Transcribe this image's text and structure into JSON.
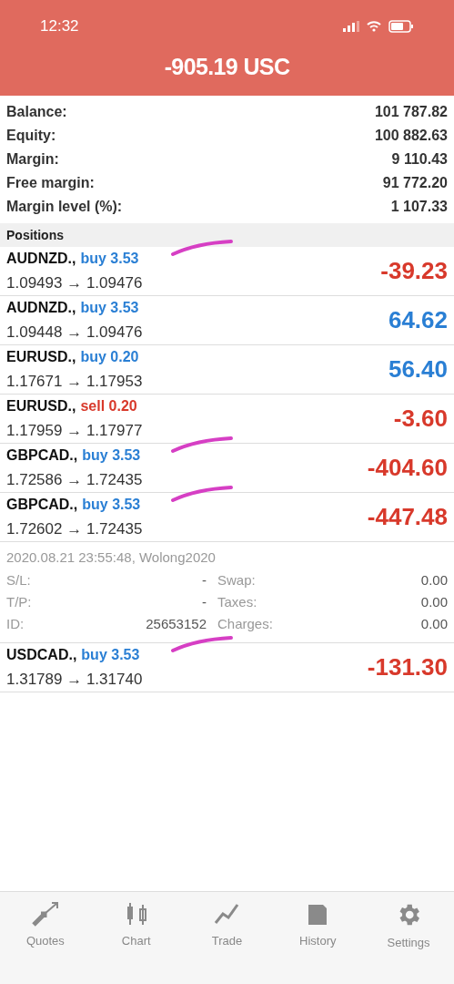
{
  "status_bar": {
    "time": "12:32"
  },
  "header": {
    "title": "-905.19 USC"
  },
  "summary": [
    {
      "label": "Balance:",
      "value": "101 787.82"
    },
    {
      "label": "Equity:",
      "value": "100 882.63"
    },
    {
      "label": "Margin:",
      "value": "9 110.43"
    },
    {
      "label": "Free margin:",
      "value": "91 772.20"
    },
    {
      "label": "Margin level (%):",
      "value": "1 107.33"
    }
  ],
  "positions_title": "Positions",
  "positions": [
    {
      "symbol": "AUDNZD.,",
      "kind": "buy",
      "order": "buy 3.53",
      "prices": "1.09493 → 1.09476",
      "profit": "-39.23",
      "color": "#d8392b",
      "marked": true
    },
    {
      "symbol": "AUDNZD.,",
      "kind": "buy",
      "order": "buy 3.53",
      "prices": "1.09448 → 1.09476",
      "profit": "64.62",
      "color": "#2a7fd4",
      "marked": false
    },
    {
      "symbol": "EURUSD.,",
      "kind": "buy",
      "order": "buy 0.20",
      "prices": "1.17671 → 1.17953",
      "profit": "56.40",
      "color": "#2a7fd4",
      "marked": false
    },
    {
      "symbol": "EURUSD.,",
      "kind": "sell",
      "order": "sell 0.20",
      "prices": "1.17959 → 1.17977",
      "profit": "-3.60",
      "color": "#d8392b",
      "marked": false
    },
    {
      "symbol": "GBPCAD.,",
      "kind": "buy",
      "order": "buy 3.53",
      "prices": "1.72586 → 1.72435",
      "profit": "-404.60",
      "color": "#d8392b",
      "marked": true
    },
    {
      "symbol": "GBPCAD.,",
      "kind": "buy",
      "order": "buy 3.53",
      "prices": "1.72602 → 1.72435",
      "profit": "-447.48",
      "color": "#d8392b",
      "marked": true,
      "details": {
        "opened": "2020.08.21 23:55:48, Wolong2020",
        "rows": [
          {
            "left_label": "S/L:",
            "left_value": "-",
            "right_label": "Swap:",
            "right_value": "0.00"
          },
          {
            "left_label": "T/P:",
            "left_value": "-",
            "right_label": "Taxes:",
            "right_value": "0.00"
          },
          {
            "left_label": "ID:",
            "left_value": "25653152",
            "right_label": "Charges:",
            "right_value": "0.00"
          }
        ]
      }
    },
    {
      "symbol": "USDCAD.,",
      "kind": "buy",
      "order": "buy 3.53",
      "prices": "1.31789 → 1.31740",
      "profit": "-131.30",
      "color": "#d8392b",
      "marked": true
    }
  ],
  "tabs": [
    {
      "label": "Quotes",
      "kind": "quotes"
    },
    {
      "label": "Chart",
      "kind": "chart"
    },
    {
      "label": "Trade",
      "kind": "trade"
    },
    {
      "label": "History",
      "kind": "history"
    },
    {
      "label": "Settings",
      "kind": "settings"
    }
  ]
}
